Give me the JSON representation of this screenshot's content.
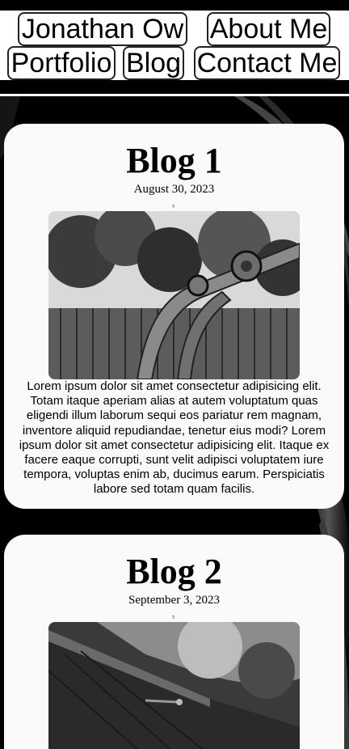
{
  "nav": {
    "items": [
      {
        "label": "Jonathan Ow"
      },
      {
        "label": "About Me"
      },
      {
        "label": "Portfolio"
      },
      {
        "label": "Blog"
      },
      {
        "label": "Contact Me"
      }
    ]
  },
  "posts": [
    {
      "title": "Blog 1",
      "date": "August 30, 2023",
      "image_caption": "black-and-white photo of rusty playground swing frame",
      "body": "Lorem ipsum dolor sit amet consectetur adipisicing elit. Totam itaque aperiam alias at autem voluptatum quas eligendi illum laborum sequi eos pariatur rem magnam, inventore aliquid repudiandae, tenetur eius modi? Lorem ipsum dolor sit amet consectetur adipisicing elit. Itaque ex facere eaque corrupti, sunt velit adipisci voluptatem iure tempora, voluptas enim ab, ducimus earum. Perspiciatis labore sed totam quam facilis."
    },
    {
      "title": "Blog 2",
      "date": "September 3, 2023",
      "image_caption": "black-and-white photo of a screw on a wooden fence",
      "body": ""
    }
  ],
  "colors": {
    "page_bg": "#000000",
    "header_bg": "#ffffff",
    "card_bg": "#fafafa",
    "accent_blue": "#1f4fd6"
  }
}
